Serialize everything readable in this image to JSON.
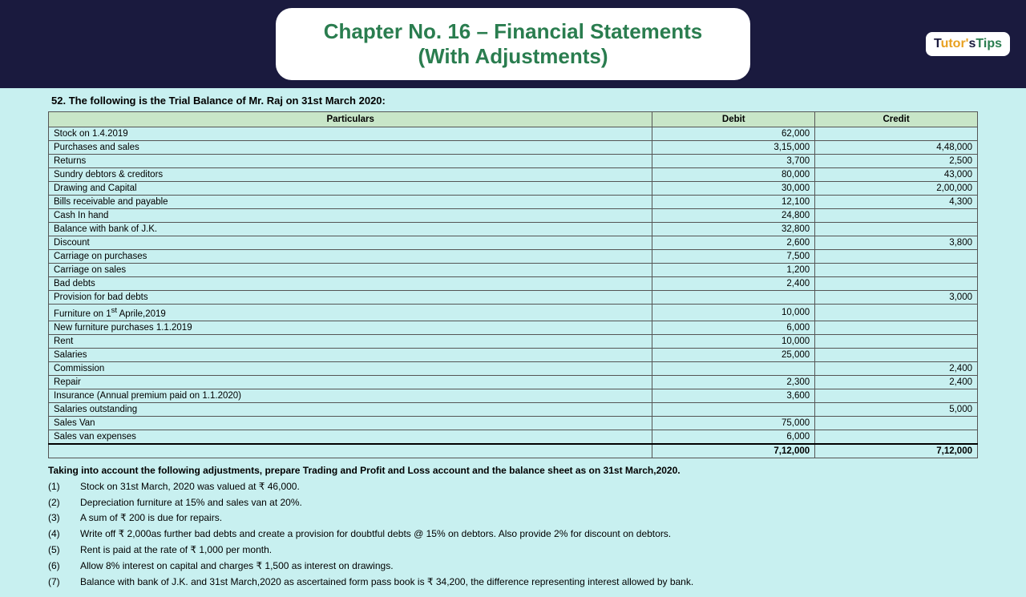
{
  "header": {
    "title_line1": "Chapter No. 16 – Financial Statements",
    "title_line2": "(With Adjustments)",
    "logo": "Tutor's Tips"
  },
  "question": {
    "number": "52.",
    "title": "The following is the Trial Balance of Mr. Raj on 31st March 2020:"
  },
  "table": {
    "columns": [
      "Particulars",
      "Debit",
      "Credit"
    ],
    "rows": [
      {
        "particulars": "Stock on 1.4.2019",
        "debit": "62,000",
        "credit": ""
      },
      {
        "particulars": "Purchases and sales",
        "debit": "3,15,000",
        "credit": "4,48,000"
      },
      {
        "particulars": "Returns",
        "debit": "3,700",
        "credit": "2,500"
      },
      {
        "particulars": "Sundry debtors & creditors",
        "debit": "80,000",
        "credit": "43,000"
      },
      {
        "particulars": "Drawing and Capital",
        "debit": "30,000",
        "credit": "2,00,000"
      },
      {
        "particulars": "Bills receivable and payable",
        "debit": "12,100",
        "credit": "4,300"
      },
      {
        "particulars": "Cash In hand",
        "debit": "24,800",
        "credit": ""
      },
      {
        "particulars": "Balance with bank of J.K.",
        "debit": "32,800",
        "credit": ""
      },
      {
        "particulars": "Discount",
        "debit": "2,600",
        "credit": "3,800"
      },
      {
        "particulars": "Carriage on purchases",
        "debit": "7,500",
        "credit": ""
      },
      {
        "particulars": "Carriage on sales",
        "debit": "1,200",
        "credit": ""
      },
      {
        "particulars": "Bad debts",
        "debit": "2,400",
        "credit": ""
      },
      {
        "particulars": "Provision for bad debts",
        "debit": "",
        "credit": "3,000"
      },
      {
        "particulars": "Furniture on 1st Aprile,2019",
        "debit": "10,000",
        "credit": ""
      },
      {
        "particulars": "New furniture purchases 1.1.2019",
        "debit": "6,000",
        "credit": ""
      },
      {
        "particulars": "Rent",
        "debit": "10,000",
        "credit": ""
      },
      {
        "particulars": "Salaries",
        "debit": "25,000",
        "credit": ""
      },
      {
        "particulars": "Commission",
        "debit": "",
        "credit": "2,400"
      },
      {
        "particulars": "Repair",
        "debit": "2,300",
        "credit": "2,400"
      },
      {
        "particulars": "Insurance (Annual premium paid on 1.1.2020)",
        "debit": "3,600",
        "credit": ""
      },
      {
        "particulars": "Salaries outstanding",
        "debit": "",
        "credit": "5,000"
      },
      {
        "particulars": "Sales Van",
        "debit": "75,000",
        "credit": ""
      },
      {
        "particulars": "Sales van expenses",
        "debit": "6,000",
        "credit": ""
      }
    ],
    "total_row": {
      "debit": "7,12,000",
      "credit": "7,12,000"
    }
  },
  "adjustments": {
    "intro": "Taking into account the following adjustments, prepare Trading and Profit and Loss account and the balance sheet as on 31st March,2020.",
    "items": [
      {
        "num": "(1)",
        "text": "Stock on 31st March, 2020 was valued at ₹ 46,000."
      },
      {
        "num": "(2)",
        "text": "Depreciation furniture at 15% and sales van at 20%."
      },
      {
        "num": "(3)",
        "text": "A sum of ₹ 200 is due for repairs."
      },
      {
        "num": "(4)",
        "text": "Write off ₹ 2,000as further bad debts and create a provision for doubtful debts @ 15% on debtors. Also provide 2% for discount on debtors."
      },
      {
        "num": "(5)",
        "text": "Rent is paid at the rate of ₹ 1,000 per month."
      },
      {
        "num": "(6)",
        "text": "Allow 8% interest on capital and charges ₹ 1,500 as interest on drawings."
      },
      {
        "num": "(7)",
        "text": "Balance with bank of J.K. and 31st March,2020 as ascertained form pass book is ₹ 34,200, the difference representing interest allowed by bank."
      }
    ]
  }
}
